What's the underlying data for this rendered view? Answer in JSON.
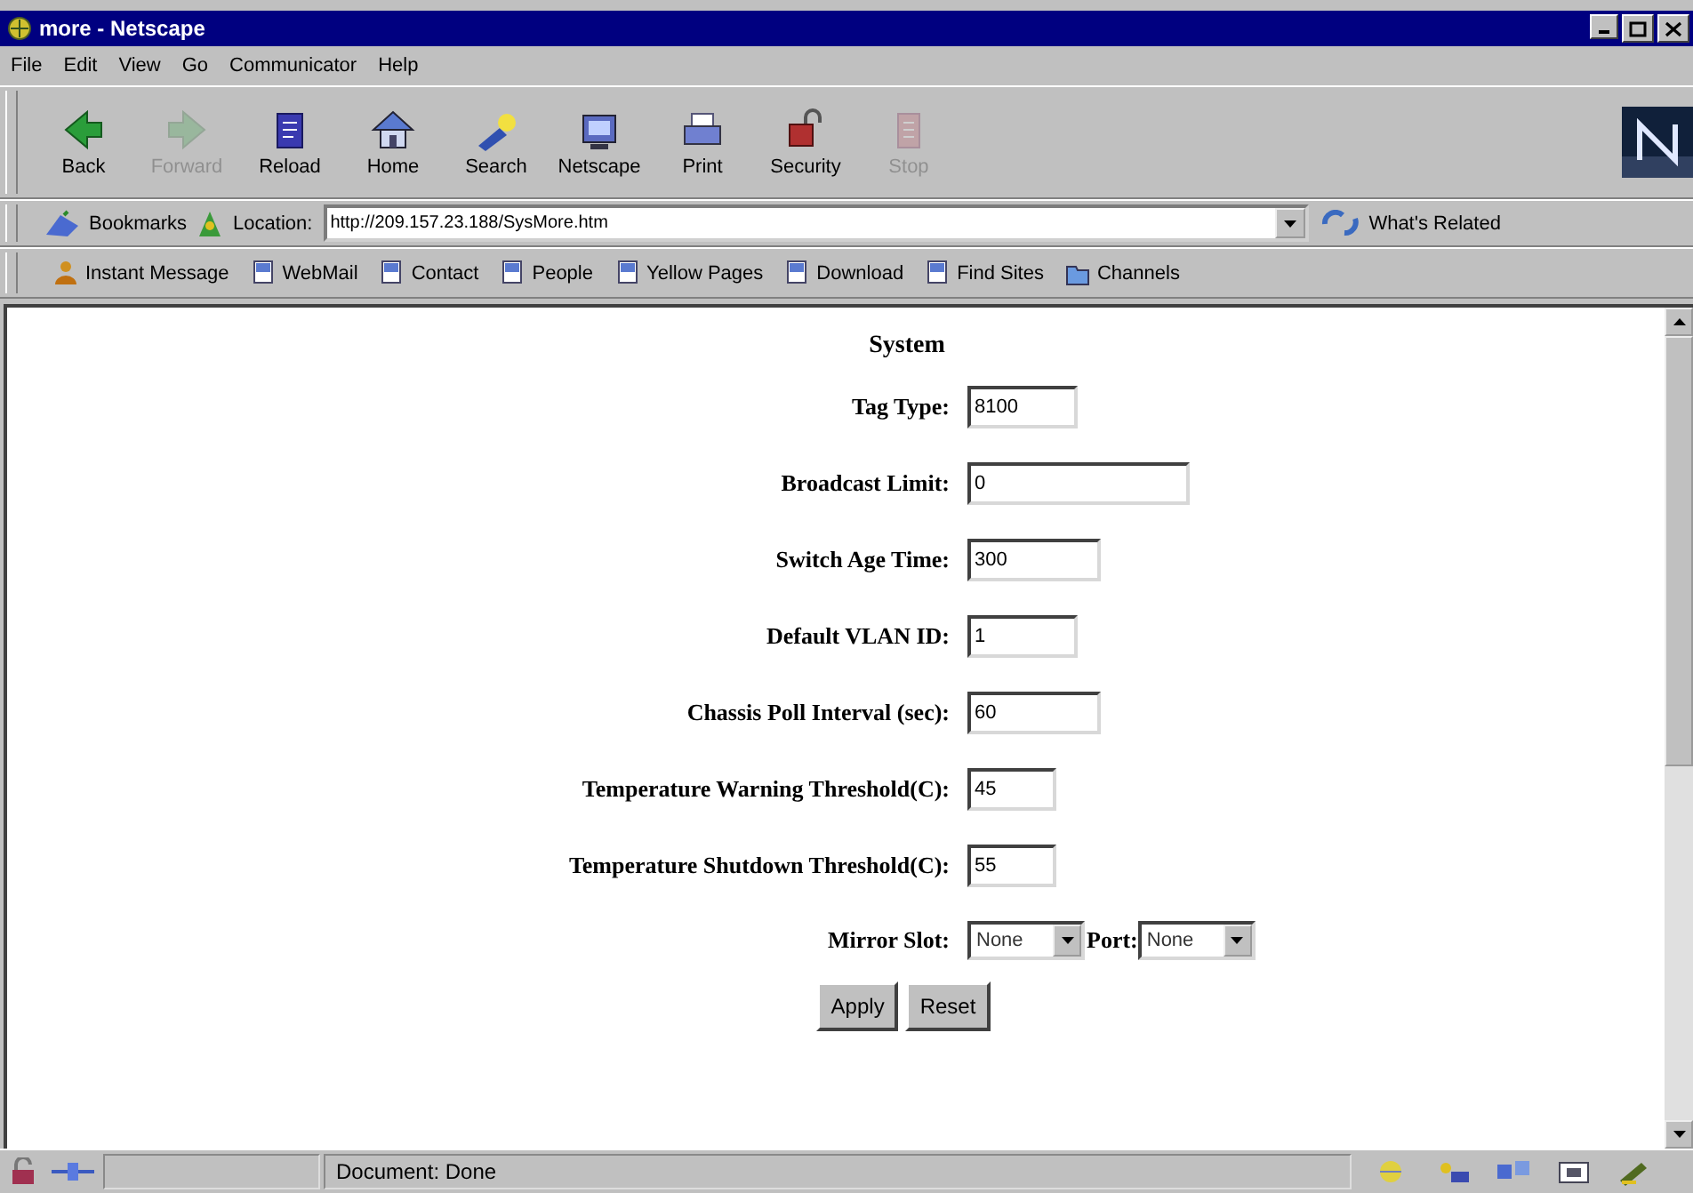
{
  "window": {
    "title": "more - Netscape"
  },
  "menu": [
    "File",
    "Edit",
    "View",
    "Go",
    "Communicator",
    "Help"
  ],
  "toolbar": [
    {
      "label": "Back",
      "kind": "back",
      "disabled": false
    },
    {
      "label": "Forward",
      "kind": "forward",
      "disabled": true
    },
    {
      "label": "Reload",
      "kind": "reload",
      "disabled": false
    },
    {
      "label": "Home",
      "kind": "home",
      "disabled": false
    },
    {
      "label": "Search",
      "kind": "search",
      "disabled": false
    },
    {
      "label": "Netscape",
      "kind": "netscape",
      "disabled": false
    },
    {
      "label": "Print",
      "kind": "print",
      "disabled": false
    },
    {
      "label": "Security",
      "kind": "security",
      "disabled": false
    },
    {
      "label": "Stop",
      "kind": "stop",
      "disabled": true
    }
  ],
  "location_bar": {
    "bookmarks": "Bookmarks",
    "label": "Location:",
    "url": "http://209.157.23.188/SysMore.htm",
    "related": "What's Related"
  },
  "personal_toolbar": [
    {
      "label": "Instant Message",
      "kind": "person"
    },
    {
      "label": "WebMail",
      "kind": "page"
    },
    {
      "label": "Contact",
      "kind": "page"
    },
    {
      "label": "People",
      "kind": "page"
    },
    {
      "label": "Yellow Pages",
      "kind": "page"
    },
    {
      "label": "Download",
      "kind": "page"
    },
    {
      "label": "Find Sites",
      "kind": "page"
    },
    {
      "label": "Channels",
      "kind": "folder"
    }
  ],
  "form": {
    "heading": "System",
    "fields": [
      {
        "label": "Tag Type:",
        "value": "8100",
        "kind": "text"
      },
      {
        "label": "Broadcast Limit:",
        "value": "0",
        "kind": "text"
      },
      {
        "label": "Switch Age Time:",
        "value": "300",
        "kind": "text"
      },
      {
        "label": "Default VLAN ID:",
        "value": "1",
        "kind": "text"
      },
      {
        "label": "Chassis Poll Interval (sec):",
        "value": "60",
        "kind": "text"
      },
      {
        "label": "Temperature Warning Threshold(C):",
        "value": "45",
        "kind": "text"
      },
      {
        "label": "Temperature Shutdown Threshold(C):",
        "value": "55",
        "kind": "text"
      },
      {
        "label": "Mirror Slot:",
        "value": "None",
        "kind": "select",
        "extra_label": "Port:",
        "extra_value": "None"
      }
    ],
    "buttons": [
      "Apply",
      "Reset"
    ]
  },
  "status_bar": {
    "text": "Document: Done"
  }
}
